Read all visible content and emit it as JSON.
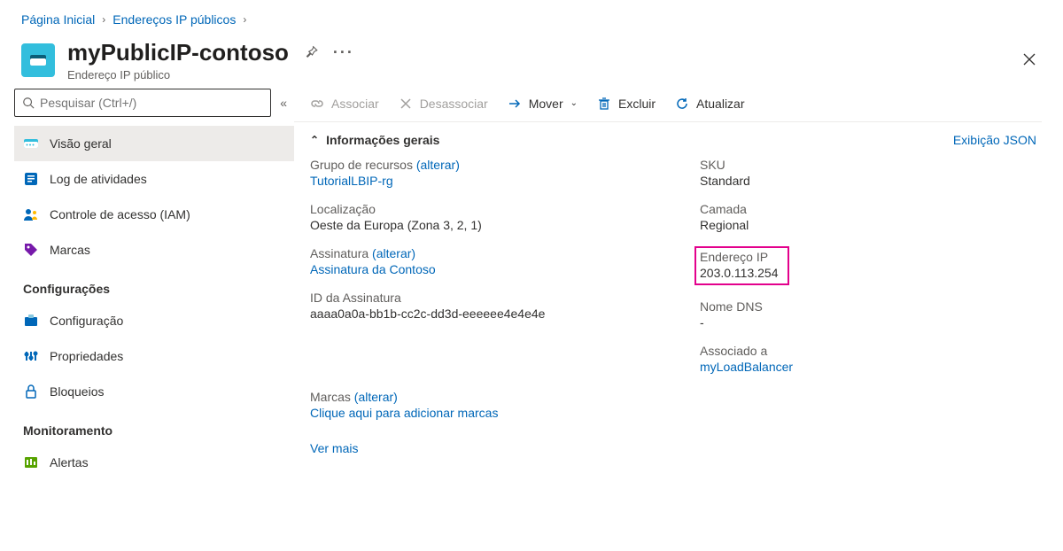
{
  "breadcrumb": {
    "home": "Página Inicial",
    "level2": "Endereços IP públicos"
  },
  "header": {
    "title": "myPublicIP-contoso",
    "subtitle": "Endereço IP público"
  },
  "search": {
    "placeholder": "Pesquisar (Ctrl+/)"
  },
  "nav": {
    "items": [
      {
        "key": "overview",
        "label": "Visão geral",
        "icon": "resource"
      },
      {
        "key": "activity",
        "label": "Log de atividades",
        "icon": "log"
      },
      {
        "key": "iam",
        "label": "Controle de acesso (IAM)",
        "icon": "iam"
      },
      {
        "key": "tags",
        "label": "Marcas",
        "icon": "tag"
      }
    ],
    "group_config": "Configurações",
    "config_items": [
      {
        "key": "configuration",
        "label": "Configuração",
        "icon": "config"
      },
      {
        "key": "properties",
        "label": "Propriedades",
        "icon": "props"
      },
      {
        "key": "locks",
        "label": "Bloqueios",
        "icon": "lock"
      }
    ],
    "group_monitor": "Monitoramento",
    "monitor_items": [
      {
        "key": "alerts",
        "label": "Alertas",
        "icon": "alert"
      }
    ]
  },
  "toolbar": {
    "associate": "Associar",
    "disassociate": "Desassociar",
    "move": "Mover",
    "delete": "Excluir",
    "refresh": "Atualizar"
  },
  "essentials": {
    "section_title": "Informações gerais",
    "json_view": "Exibição JSON",
    "left": {
      "rg_label": "Grupo de recursos",
      "rg_change": "(alterar)",
      "rg_value": "TutorialLBIP-rg",
      "loc_label": "Localização",
      "loc_value": "Oeste da Europa (Zona 3, 2, 1)",
      "sub_label": "Assinatura",
      "sub_change": "(alterar)",
      "sub_value": "Assinatura da Contoso",
      "subid_label": "ID da Assinatura",
      "subid_value": "aaaa0a0a-bb1b-cc2c-dd3d-eeeeee4e4e4e"
    },
    "right": {
      "sku_label": "SKU",
      "sku_value": "Standard",
      "tier_label": "Camada",
      "tier_value": "Regional",
      "ip_label": "Endereço IP",
      "ip_value": "203.0.113.254",
      "dns_label": "Nome DNS",
      "dns_value": "-",
      "assoc_label": "Associado a",
      "assoc_value": "myLoadBalancer"
    },
    "marcas_label": "Marcas",
    "marcas_change": "(alterar)",
    "marcas_value": "Clique aqui para adicionar marcas",
    "see_more": "Ver mais"
  }
}
